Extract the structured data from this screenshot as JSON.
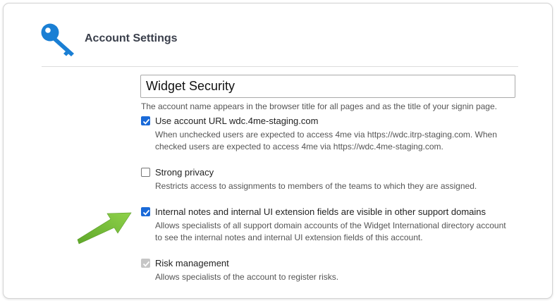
{
  "header": {
    "title": "Account Settings",
    "icon": "key-icon",
    "icon_color": "#1a7fd4"
  },
  "account_name": {
    "value": "Widget Security",
    "hint": "The account name appears in the browser title for all pages and as the title of your signin page."
  },
  "options": [
    {
      "id": "use-account-url",
      "label": "Use account URL wdc.4me-staging.com",
      "description": "When unchecked users are expected to access 4me via https://wdc.itrp-staging.com. When checked users are expected to access 4me via https://wdc.4me-staging.com.",
      "checked": true,
      "disabled": false
    },
    {
      "id": "strong-privacy",
      "label": "Strong privacy",
      "description": "Restricts access to assignments to members of the teams to which they are assigned.",
      "checked": false,
      "disabled": false
    },
    {
      "id": "internal-notes-visible",
      "label": "Internal notes and internal UI extension fields are visible in other support domains",
      "description": "Allows specialists of all support domain accounts of the Widget International directory account to see the internal notes and internal UI extension fields of this account.",
      "checked": true,
      "disabled": false
    },
    {
      "id": "risk-management",
      "label": "Risk management",
      "description": "Allows specialists of the account to register risks.",
      "checked": true,
      "disabled": true
    }
  ],
  "colors": {
    "accent": "#1a6ad8",
    "arrow": "#7ac03a"
  }
}
